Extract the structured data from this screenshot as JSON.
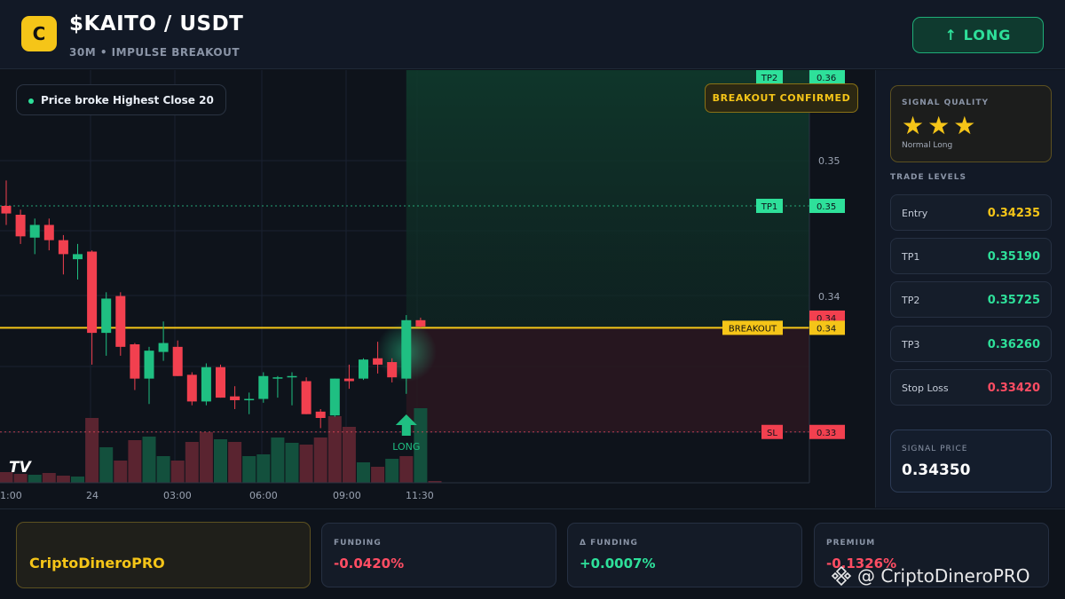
{
  "header": {
    "logo_letter": "C",
    "title": "$KAITO / USDT",
    "subtitle": "30M • IMPULSE BREAKOUT",
    "long_button": "↑ LONG"
  },
  "chart_badges": {
    "info": "Price broke Highest Close 20",
    "breakout_confirmed": "BREAKOUT CONFIRMED",
    "long_marker": "LONG"
  },
  "price_tags": {
    "tp2_label": "TP2",
    "tp2_value": "0.36",
    "tp1_label": "TP1",
    "tp1_value": "0.35",
    "last_value": "0.34",
    "breakout_label": "BREAKOUT",
    "breakout_value": "0.34",
    "sl_label": "SL",
    "sl_value": "0.33"
  },
  "watermark_chart": "TV",
  "sidebar": {
    "signal_quality_label": "SIGNAL QUALITY",
    "stars": "★★★",
    "quality_text": "Normal Long",
    "trade_levels_label": "TRADE LEVELS",
    "levels": [
      {
        "name": "Entry",
        "value": "0.34235",
        "color": "#f5c518"
      },
      {
        "name": "TP1",
        "value": "0.35190",
        "color": "#2ee09a"
      },
      {
        "name": "TP2",
        "value": "0.35725",
        "color": "#2ee09a"
      },
      {
        "name": "TP3",
        "value": "0.36260",
        "color": "#2ee09a"
      },
      {
        "name": "Stop Loss",
        "value": "0.33420",
        "color": "#ff4d63"
      }
    ],
    "signal_price_label": "SIGNAL PRICE",
    "signal_price": "0.34350"
  },
  "footer": {
    "brand": "CriptoDineroPRO",
    "funding_label": "FUNDING",
    "funding_value": "-0.0420%",
    "delta_label": "Δ FUNDING",
    "delta_value": "+0.0007%",
    "premium_label": "PREMIUM",
    "premium_value": "-0.1326%",
    "watermark": "@ CriptoDineroPRO"
  },
  "colors": {
    "up": "#1fbf82",
    "down": "#f2404f",
    "breakout": "#f5c518",
    "tp": "#2ee09a",
    "sl": "#ff4d63"
  },
  "chart_data": {
    "type": "candlestick",
    "y_ticks": [
      "0.35",
      "0.34",
      "0.34",
      "0.33"
    ],
    "y_tick_values": [
      0.35,
      0.34,
      0.34,
      0.33
    ],
    "x_tick_labels": [
      "1:00",
      "24",
      "03:00",
      "06:00",
      "09:00",
      "11:30"
    ],
    "ylim": [
      0.3302,
      0.3622
    ],
    "levels": {
      "tp2": 0.362,
      "tp1": 0.352,
      "breakout": 0.3424,
      "sl": 0.3342
    },
    "candles": [
      {
        "o": 0.352,
        "h": 0.354,
        "l": 0.3505,
        "c": 0.3514
      },
      {
        "o": 0.3513,
        "h": 0.3517,
        "l": 0.349,
        "c": 0.3496
      },
      {
        "o": 0.3495,
        "h": 0.351,
        "l": 0.3482,
        "c": 0.3505
      },
      {
        "o": 0.3505,
        "h": 0.351,
        "l": 0.3485,
        "c": 0.3493
      },
      {
        "o": 0.3493,
        "h": 0.3497,
        "l": 0.3466,
        "c": 0.3482
      },
      {
        "o": 0.3478,
        "h": 0.349,
        "l": 0.3462,
        "c": 0.3482
      },
      {
        "o": 0.3484,
        "h": 0.3485,
        "l": 0.3395,
        "c": 0.342
      },
      {
        "o": 0.342,
        "h": 0.3452,
        "l": 0.3402,
        "c": 0.3447
      },
      {
        "o": 0.3449,
        "h": 0.3452,
        "l": 0.3402,
        "c": 0.3409
      },
      {
        "o": 0.3411,
        "h": 0.3412,
        "l": 0.3375,
        "c": 0.3384
      },
      {
        "o": 0.3384,
        "h": 0.3409,
        "l": 0.3364,
        "c": 0.3406
      },
      {
        "o": 0.3405,
        "h": 0.3429,
        "l": 0.3398,
        "c": 0.3412
      },
      {
        "o": 0.3409,
        "h": 0.3414,
        "l": 0.3386,
        "c": 0.3386
      },
      {
        "o": 0.3387,
        "h": 0.3389,
        "l": 0.3363,
        "c": 0.3366
      },
      {
        "o": 0.3366,
        "h": 0.3396,
        "l": 0.3363,
        "c": 0.3393
      },
      {
        "o": 0.3393,
        "h": 0.3395,
        "l": 0.3369,
        "c": 0.3369
      },
      {
        "o": 0.337,
        "h": 0.3378,
        "l": 0.336,
        "c": 0.3367
      },
      {
        "o": 0.3368,
        "h": 0.3373,
        "l": 0.3356,
        "c": 0.3368
      },
      {
        "o": 0.3368,
        "h": 0.3389,
        "l": 0.3365,
        "c": 0.3386
      },
      {
        "o": 0.3385,
        "h": 0.3386,
        "l": 0.3369,
        "c": 0.3385
      },
      {
        "o": 0.3385,
        "h": 0.3389,
        "l": 0.3363,
        "c": 0.3386
      },
      {
        "o": 0.3382,
        "h": 0.3385,
        "l": 0.3356,
        "c": 0.3356
      },
      {
        "o": 0.3358,
        "h": 0.336,
        "l": 0.3345,
        "c": 0.3353
      },
      {
        "o": 0.3355,
        "h": 0.3384,
        "l": 0.3354,
        "c": 0.3384
      },
      {
        "o": 0.3384,
        "h": 0.3395,
        "l": 0.3376,
        "c": 0.3382
      },
      {
        "o": 0.3384,
        "h": 0.34,
        "l": 0.3383,
        "c": 0.3399
      },
      {
        "o": 0.34,
        "h": 0.3413,
        "l": 0.3388,
        "c": 0.3395
      },
      {
        "o": 0.3397,
        "h": 0.34,
        "l": 0.3381,
        "c": 0.3385
      },
      {
        "o": 0.3384,
        "h": 0.3434,
        "l": 0.3372,
        "c": 0.343
      },
      {
        "o": 0.343,
        "h": 0.3432,
        "l": 0.3424,
        "c": 0.3425
      }
    ],
    "volume": [
      12,
      10,
      9,
      11,
      8,
      7,
      73,
      40,
      25,
      48,
      52,
      30,
      25,
      46,
      57,
      49,
      46,
      30,
      32,
      51,
      45,
      43,
      51,
      75,
      63,
      23,
      18,
      27,
      30,
      84,
      2
    ],
    "volume_colors": [
      "d",
      "d",
      "u",
      "d",
      "d",
      "u",
      "d",
      "u",
      "d",
      "d",
      "u",
      "u",
      "d",
      "d",
      "d",
      "u",
      "d",
      "u",
      "u",
      "u",
      "u",
      "d",
      "d",
      "d",
      "d",
      "u",
      "d",
      "u",
      "d",
      "u",
      "d"
    ]
  }
}
